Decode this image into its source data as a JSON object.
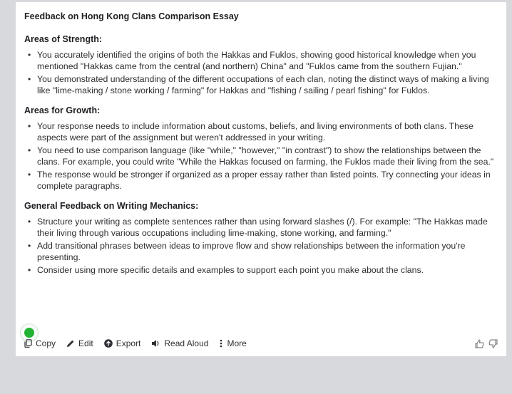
{
  "title": "Feedback on Hong Kong Clans Comparison Essay",
  "sections": [
    {
      "heading": "Areas of Strength:",
      "items": [
        "You accurately identified the origins of both the Hakkas and Fuklos, showing good historical knowledge when you mentioned \"Hakkas came from the central (and northern) China\" and \"Fuklos came from the southern Fujian.\"",
        "You demonstrated understanding of the different occupations of each clan, noting the distinct ways of making a living like \"lime-making / stone working / farming\" for Hakkas and \"fishing / sailing / pearl fishing\" for Fuklos."
      ]
    },
    {
      "heading": "Areas for Growth:",
      "items": [
        "Your response needs to include information about customs, beliefs, and living environments of both clans. These aspects were part of the assignment but weren't addressed in your writing.",
        "You need to use comparison language (like \"while,\" \"however,\" \"in contrast\") to show the relationships between the clans. For example, you could write \"While the Hakkas focused on farming, the Fuklos made their living from the sea.\"",
        "The response would be stronger if organized as a proper essay rather than listed points. Try connecting your ideas in complete paragraphs."
      ]
    },
    {
      "heading": "General Feedback on Writing Mechanics:",
      "items": [
        "Structure your writing as complete sentences rather than using forward slashes (/). For example: \"The Hakkas made their living through various occupations including lime-making, stone working, and farming.\"",
        "Add transitional phrases between ideas to improve flow and show relationships between the information you're presenting.",
        "Consider using more specific details and examples to support each point you make about the clans."
      ]
    }
  ],
  "toolbar": {
    "copy": "Copy",
    "edit": "Edit",
    "export": "Export",
    "read_aloud": "Read Aloud",
    "more": "More"
  },
  "colors": {
    "status_dot": "#22b333",
    "background": "#d8d9dc",
    "card": "#ffffff"
  }
}
